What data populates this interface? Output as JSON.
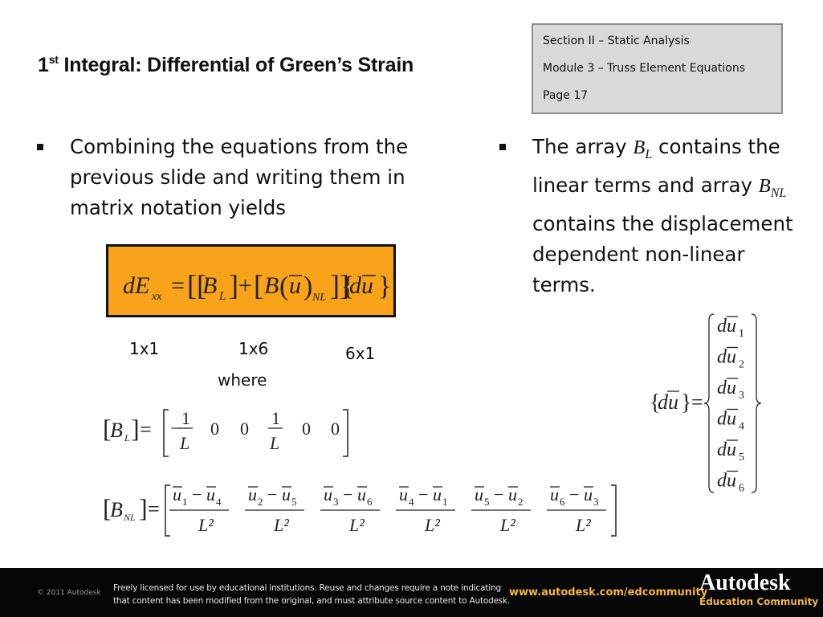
{
  "slide": {
    "title_prefix": "1",
    "title_superscript": "st",
    "title_rest": " Integral: Differential of Green’s Strain"
  },
  "infobox": {
    "section": "Section II – Static Analysis",
    "module": "Module 3 – Truss Element Equations",
    "page": "Page 17"
  },
  "left_bullet": {
    "lines": [
      "Combining the equations from the",
      "previous slide and writing them in",
      "matrix notation yields"
    ]
  },
  "right_bullet": {
    "line1_pre": "The array ",
    "line1_var": "B",
    "line1_sub": "L",
    "line1_post": " contains the",
    "line2_pre": "linear terms and array ",
    "line2_var": "B",
    "line2_sub": "NL",
    "line3": "contains the displacement",
    "line4": "dependent non-linear",
    "line5": "terms."
  },
  "main_equation": {
    "lhs": "dE",
    "lhs_sub": "xx",
    "term1": "B",
    "term1_sub": "L",
    "term2": "B",
    "term2_arg": "u",
    "term2_sub": "NL",
    "vector": "du",
    "highlight_color": "#f9a31a"
  },
  "dimensions": {
    "d1": "1x1",
    "d2": "1x6",
    "d3": "6x1",
    "where": "where"
  },
  "bl_matrix": {
    "label": "B",
    "label_sub": "L",
    "entries": [
      "-1/L",
      "0",
      "0",
      "1/L",
      "0",
      "0"
    ]
  },
  "bnl_matrix": {
    "label": "B",
    "label_sub": "NL",
    "entries": [
      {
        "a": "1",
        "b": "4"
      },
      {
        "a": "2",
        "b": "5"
      },
      {
        "a": "3",
        "b": "6"
      },
      {
        "a": "4",
        "b": "1"
      },
      {
        "a": "5",
        "b": "2"
      },
      {
        "a": "6",
        "b": "3"
      }
    ],
    "denominator": "L²"
  },
  "du_vector": {
    "label": "du",
    "entries": [
      "1",
      "2",
      "3",
      "4",
      "5",
      "6"
    ]
  },
  "footer": {
    "copyright": "© 2011 Autodesk",
    "license_line1": "Freely licensed for use by educational institutions. Reuse and changes require a note indicating",
    "license_line2": "that content has been modified from the original, and must attribute source content to Autodesk.",
    "url": "www.autodesk.com/edcommunity",
    "brand": "Autodesk",
    "brand_sub": "Education Community",
    "accent_color": "#f5b640"
  }
}
